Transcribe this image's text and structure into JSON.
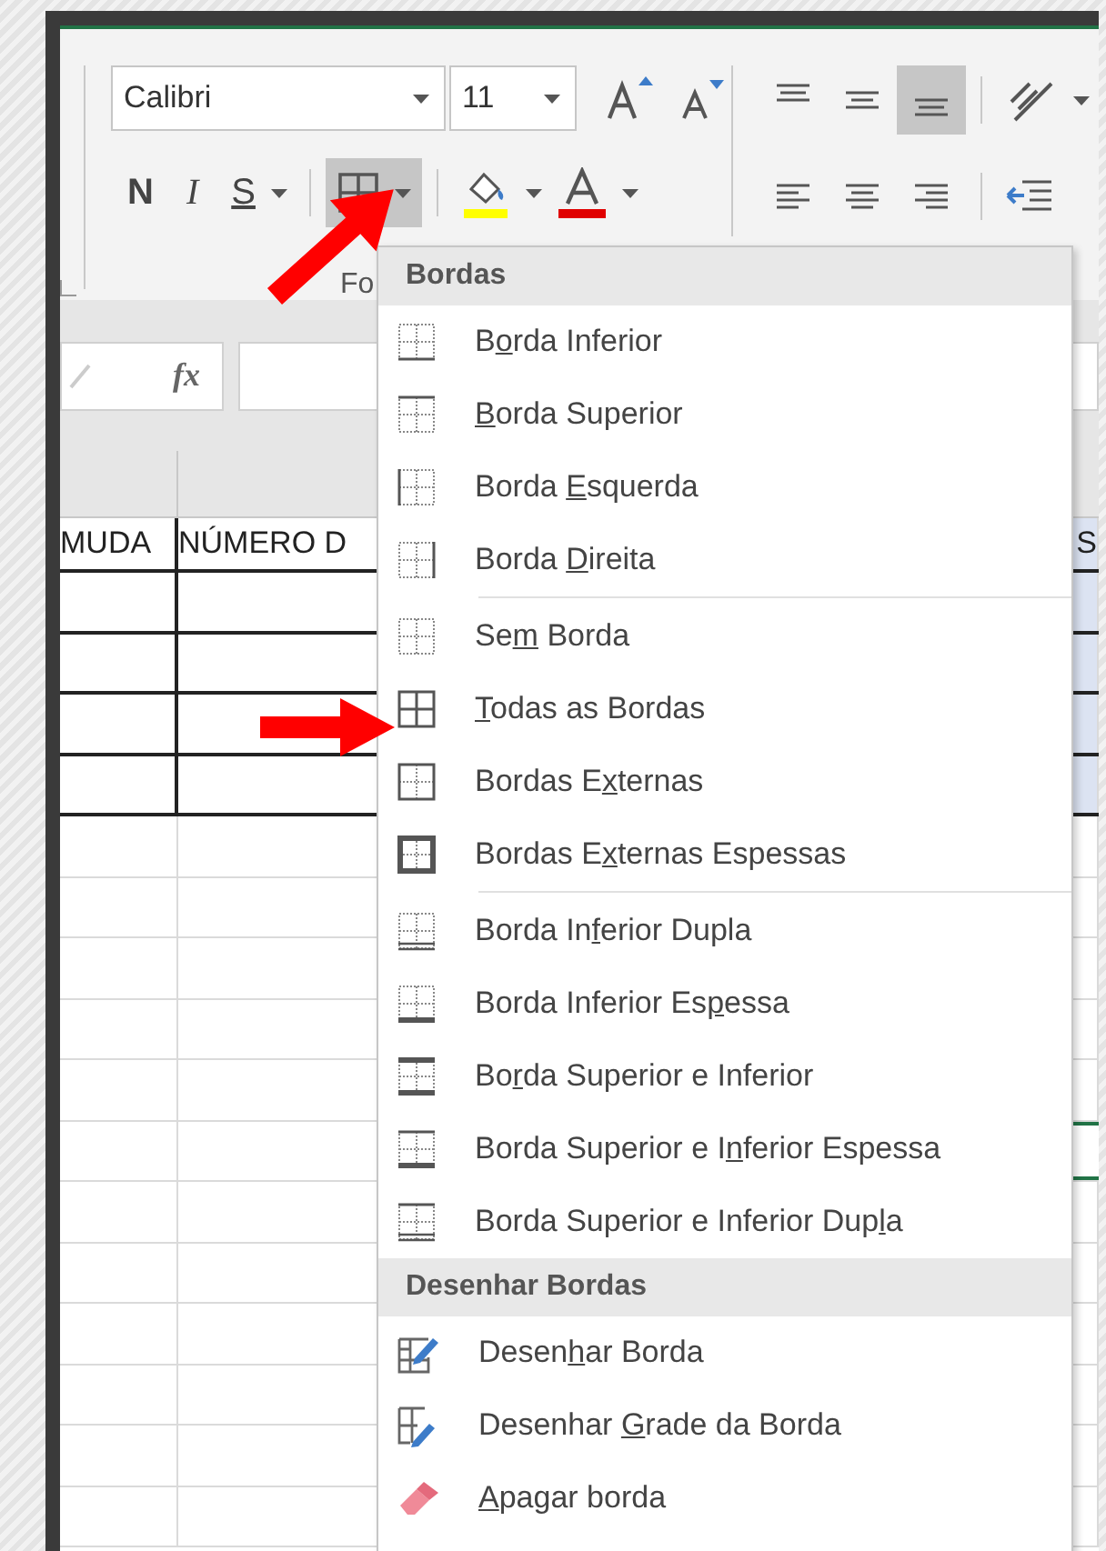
{
  "ribbon": {
    "font_name": "Calibri",
    "font_size": "11",
    "style_buttons": [
      {
        "kind": "bold",
        "label": "N"
      },
      {
        "kind": "italic",
        "label": "I"
      },
      {
        "kind": "underline",
        "label": "S"
      }
    ],
    "borders_button": {
      "selected": true
    },
    "vertical_align": [
      {
        "kind": "top",
        "selected": false
      },
      {
        "kind": "middle",
        "selected": false
      },
      {
        "kind": "bottom",
        "selected": true
      }
    ],
    "horizontal_align": [
      {
        "kind": "left",
        "selected": false
      },
      {
        "kind": "center",
        "selected": false
      },
      {
        "kind": "right",
        "selected": false
      }
    ],
    "group_label": "Fo"
  },
  "formula_bar": {
    "function_label": "fx"
  },
  "sheet": {
    "rows": [
      {
        "kind": "header",
        "cells": [
          "MUDA",
          "NÚMERO D",
          "S"
        ],
        "selected": false
      },
      {
        "kind": "bordered",
        "cells": [],
        "selected": false
      },
      {
        "kind": "bordered",
        "cells": [],
        "selected": false
      },
      {
        "kind": "bordered",
        "cells": [],
        "selected": false
      },
      {
        "kind": "bordered",
        "cells": [],
        "selected": false
      },
      {
        "kind": "plain",
        "cells": [],
        "selected": false
      },
      {
        "kind": "plain",
        "cells": [],
        "selected": false
      },
      {
        "kind": "plain",
        "cells": [],
        "selected": false
      },
      {
        "kind": "plain",
        "cells": [],
        "selected": false
      },
      {
        "kind": "plain",
        "cells": [],
        "selected": false
      },
      {
        "kind": "plain",
        "cells": [],
        "selected": true
      },
      {
        "kind": "plain",
        "cells": [],
        "selected": false
      },
      {
        "kind": "plain",
        "cells": [],
        "selected": false
      },
      {
        "kind": "plain",
        "cells": [],
        "selected": false
      },
      {
        "kind": "plain",
        "cells": [],
        "selected": false
      },
      {
        "kind": "plain",
        "cells": [],
        "selected": false
      },
      {
        "kind": "plain",
        "cells": [],
        "selected": false
      }
    ]
  },
  "border_menu": {
    "sections": [
      {
        "title": "Bordas",
        "items": [
          {
            "kind": "bottom",
            "label_start": "B",
            "access_key": "o",
            "label_end": "rda Inferior"
          },
          {
            "kind": "top",
            "access_key": "B",
            "label_end": "orda Superior"
          },
          {
            "kind": "left",
            "label_start": "Borda ",
            "access_key": "E",
            "label_end": "squerda"
          },
          {
            "kind": "right",
            "label_start": "Borda ",
            "access_key": "D",
            "label_end": "ireita"
          },
          {
            "kind": "separator"
          },
          {
            "kind": "none",
            "label_start": "Se",
            "access_key": "m",
            "label_end": " Borda"
          },
          {
            "kind": "all",
            "access_key": "T",
            "label_end": "odas as Bordas"
          },
          {
            "kind": "outside",
            "label_start": "Bordas E",
            "access_key": "x",
            "label_end": "ternas"
          },
          {
            "kind": "thick_outside",
            "label_start": "Bordas E",
            "access_key": "x",
            "label_end": "ternas Espessas"
          },
          {
            "kind": "separator"
          },
          {
            "kind": "double_bottom",
            "label_start": "Borda In",
            "access_key": "f",
            "label_end": "erior Dupla"
          },
          {
            "kind": "thick_bottom",
            "label_start": "Borda Inferior Es",
            "access_key": "p",
            "label_end": "essa"
          },
          {
            "kind": "top_bottom",
            "label_start": "Bo",
            "access_key": "r",
            "label_end": "da Superior e Inferior"
          },
          {
            "kind": "top_thick_bottom",
            "label_start": "Borda Superior e I",
            "access_key": "n",
            "label_end": "ferior Espessa"
          },
          {
            "kind": "top_double_bottom",
            "label_start": "Borda Superior e Inferior Dup",
            "access_key": "l",
            "label_end": "a"
          }
        ]
      },
      {
        "title": "Desenhar Bordas",
        "items": [
          {
            "kind": "draw",
            "label_start": "Desen",
            "access_key": "h",
            "label_end": "ar Borda"
          },
          {
            "kind": "draw_grid",
            "label_start": "Desenhar ",
            "access_key": "G",
            "label_end": "rade da Borda"
          },
          {
            "kind": "erase",
            "access_key": "A",
            "label_end": "pagar borda"
          }
        ]
      }
    ]
  }
}
